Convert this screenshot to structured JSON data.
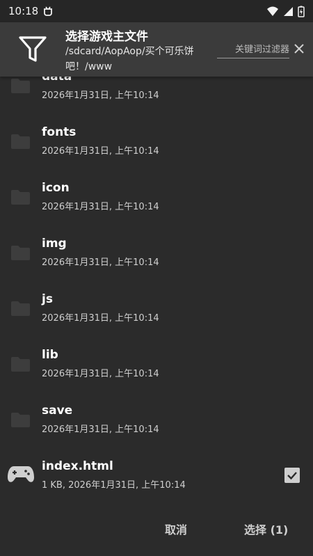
{
  "status_bar": {
    "time": "10:18"
  },
  "header": {
    "title": "选择游戏主文件",
    "path": "/sdcard/AopAop/买个可乐饼吧！/www",
    "filter_placeholder": "关键词过滤器"
  },
  "files": [
    {
      "name": "data",
      "meta": "2026年1月31日, 上午10:14",
      "type": "folder"
    },
    {
      "name": "fonts",
      "meta": "2026年1月31日, 上午10:14",
      "type": "folder"
    },
    {
      "name": "icon",
      "meta": "2026年1月31日, 上午10:14",
      "type": "folder"
    },
    {
      "name": "img",
      "meta": "2026年1月31日, 上午10:14",
      "type": "folder"
    },
    {
      "name": "js",
      "meta": "2026年1月31日, 上午10:14",
      "type": "folder"
    },
    {
      "name": "lib",
      "meta": "2026年1月31日, 上午10:14",
      "type": "folder"
    },
    {
      "name": "save",
      "meta": "2026年1月31日, 上午10:14",
      "type": "folder"
    },
    {
      "name": "index.html",
      "meta": "1 KB, 2026年1月31日, 上午10:14",
      "type": "game",
      "checked": true
    }
  ],
  "actions": {
    "cancel": "取消",
    "select": "选择 (1)"
  },
  "colors": {
    "background": "#2b2b2b",
    "header": "#3b3b3b",
    "text": "#ffffff",
    "secondary_text": "#cfcfcf",
    "folder_icon": "#3d3d3d"
  }
}
